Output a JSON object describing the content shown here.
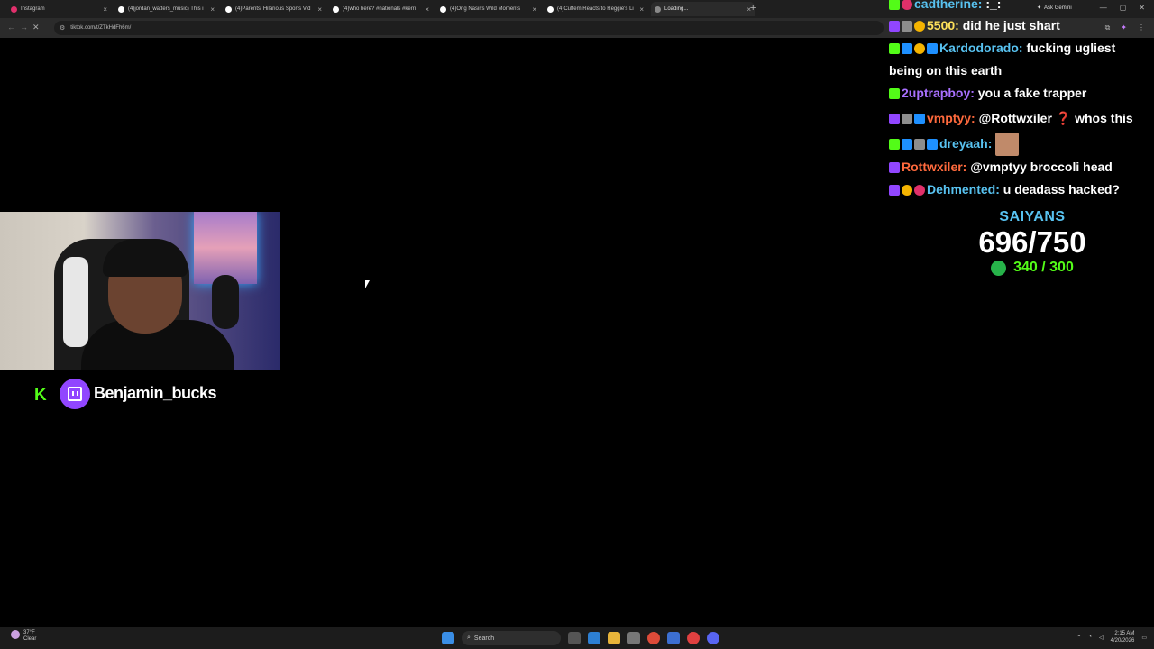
{
  "browser": {
    "tabs": [
      {
        "title": "Instagram",
        "color": "#e1306c"
      },
      {
        "title": "(4)jordan_watters_music) This i",
        "color": "#ffffff"
      },
      {
        "title": "(4)Parents' Hilarious Sports Vid",
        "color": "#ffffff"
      },
      {
        "title": "(4)who here? #nationals #kerri",
        "color": "#ffffff"
      },
      {
        "title": "(4)Ong Nasir's Wild Moments",
        "color": "#ffffff"
      },
      {
        "title": "(4)Cuffem Reacts to Reggie's Li",
        "color": "#ffffff"
      },
      {
        "title": "Loading...",
        "color": "#888888"
      }
    ],
    "new_tab": "+",
    "ask_gemini": "Ask Gemini",
    "url": "tiktok.com/t/ZTkHdFh6m/"
  },
  "streamer": {
    "kick_logo": "K",
    "name": "Benjamin_bucks"
  },
  "chat": [
    {
      "user": "cadtherine:",
      "user_color": "#58c2f0",
      "text": " :_:",
      "badges": [
        "kick",
        "heart"
      ]
    },
    {
      "user": "5500:",
      "user_color": "#ffe25b",
      "text": " did he just shart",
      "badges": [
        "twitch",
        "grey",
        "gold"
      ]
    },
    {
      "user": "Kardodorado:",
      "user_color": "#58c2f0",
      "text": " fucking ugliest",
      "badges": [
        "kick",
        "blue",
        "gold",
        "blue"
      ]
    },
    {
      "user": "",
      "user_color": "#ffffff",
      "text": "being on this earth",
      "badges": []
    },
    {
      "user": "2uptrapboy:",
      "user_color": "#a970ff",
      "text": " you a fake trapper",
      "badges": [
        "kick"
      ]
    },
    {
      "user": "vmptyy:",
      "user_color": "#ff6a3d",
      "text": " @Rottwxiler  ❓ whos this",
      "badges": [
        "twitch",
        "grey",
        "blue"
      ]
    },
    {
      "user": "dreyaah:",
      "user_color": "#58c2f0",
      "text": "",
      "badges": [
        "kick",
        "blue",
        "grey",
        "blue"
      ],
      "emote": "face-emote"
    },
    {
      "user": "Rottwxiler:",
      "user_color": "#ff6a3d",
      "text": " @vmptyy broccoli head",
      "badges": [
        "twitch"
      ]
    },
    {
      "user": "Dehmented:",
      "user_color": "#58c2f0",
      "text": " u deadass hacked?",
      "badges": [
        "twitch",
        "gold",
        "heart"
      ]
    }
  ],
  "goal": {
    "title": "SAIYANS",
    "count": "696/750",
    "sub": "340 / 300"
  },
  "taskbar": {
    "temp": "37°F",
    "condition": "Clear",
    "search": "Search",
    "time": "2:15 AM",
    "date": "4/20/2026"
  }
}
